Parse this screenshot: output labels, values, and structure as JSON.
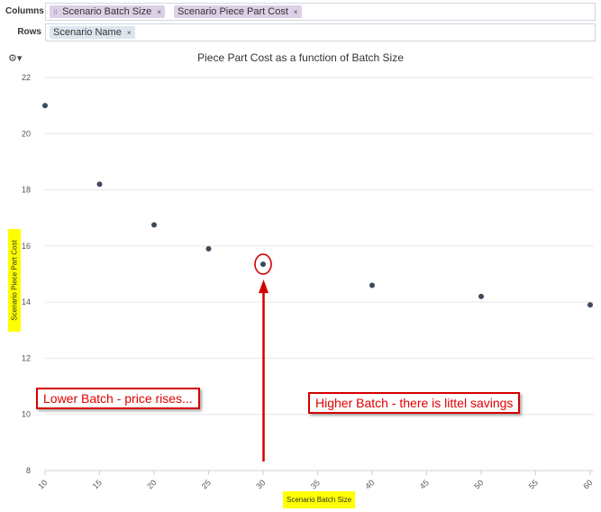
{
  "shelves": {
    "columns": {
      "label": "Columns",
      "pills": [
        {
          "label": "Scenario Batch Size",
          "close": "×"
        },
        {
          "label": "Scenario Piece Part Cost",
          "close": "×"
        }
      ],
      "grip": "⠿"
    },
    "rows": {
      "label": "Rows",
      "pills": [
        {
          "label": "Scenario Name",
          "close": "×"
        }
      ]
    }
  },
  "toolbar": {
    "settings_icon": "gear-icon",
    "settings_glyph": "⚙▾"
  },
  "chart_data": {
    "type": "scatter",
    "title": "Piece Part Cost as a function of Batch Size",
    "xlabel": "Scenario Batch Size",
    "ylabel": "Scenario Piece Part Cost",
    "xlim": [
      10,
      60
    ],
    "ylim": [
      8,
      22
    ],
    "x_ticks": [
      10,
      15,
      20,
      25,
      30,
      35,
      40,
      45,
      50,
      55,
      60
    ],
    "y_ticks": [
      8,
      10,
      12,
      14,
      16,
      18,
      20,
      22
    ],
    "grid": "horizontal",
    "legend": "none",
    "point_color": "#3d4a5c",
    "points": [
      {
        "x": 10,
        "y": 21.0
      },
      {
        "x": 15,
        "y": 18.2
      },
      {
        "x": 20,
        "y": 16.75
      },
      {
        "x": 25,
        "y": 15.9
      },
      {
        "x": 30,
        "y": 15.35
      },
      {
        "x": 40,
        "y": 14.6
      },
      {
        "x": 50,
        "y": 14.2
      },
      {
        "x": 60,
        "y": 13.9
      }
    ],
    "annotations": [
      {
        "text": "Lower Batch - price rises..."
      },
      {
        "text": "Higher Batch - there is littel savings"
      }
    ],
    "highlight": {
      "x": 30,
      "y": 15.35,
      "color": "#d40000"
    }
  }
}
